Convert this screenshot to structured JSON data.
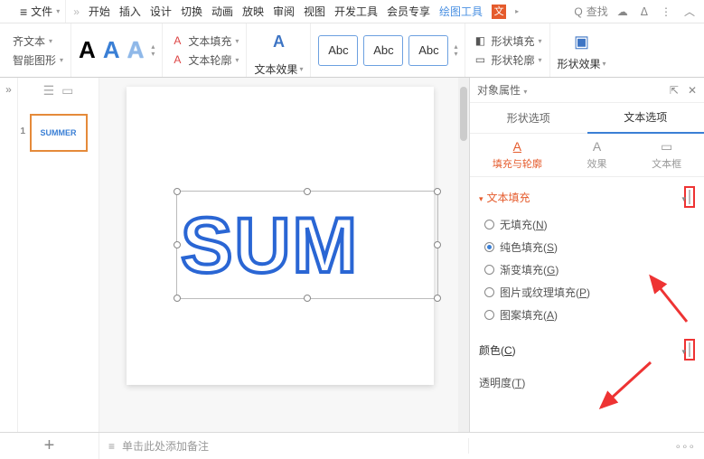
{
  "header": {
    "file_label": "文件"
  },
  "tabs": {
    "items": [
      "开始",
      "插入",
      "设计",
      "切换",
      "动画",
      "放映",
      "审阅",
      "视图",
      "开发工具",
      "会员专享",
      "绘图工具"
    ],
    "active": "绘图工具",
    "more": "文"
  },
  "search": {
    "placeholder": "查找"
  },
  "ribbon": {
    "align_text": "齐文本",
    "smartart": "智能图形",
    "text_fill": "文本填充",
    "text_outline": "文本轮廓",
    "text_effects": "文本效果",
    "abc": "Abc",
    "shape_fill": "形状填充",
    "shape_outline": "形状轮廓",
    "shape_effects": "形状效果"
  },
  "thumb": {
    "text": "SUMMER",
    "num": "1"
  },
  "canvas": {
    "text": "SUM"
  },
  "panel": {
    "title": "对象属性",
    "tab_shape": "形状选项",
    "tab_text": "文本选项",
    "sub_fill": "填充与轮廓",
    "sub_effect": "效果",
    "sub_box": "文本框",
    "section_fill": "文本填充",
    "radio_none": "无填充(N)",
    "radio_solid": "纯色填充(S)",
    "radio_gradient": "渐变填充(G)",
    "radio_picture": "图片或纹理填充(P)",
    "radio_pattern": "图案填充(A)",
    "color_label": "颜色(C)",
    "opacity_label": "透明度(T)"
  },
  "footer": {
    "notes_placeholder": "单击此处添加备注"
  }
}
